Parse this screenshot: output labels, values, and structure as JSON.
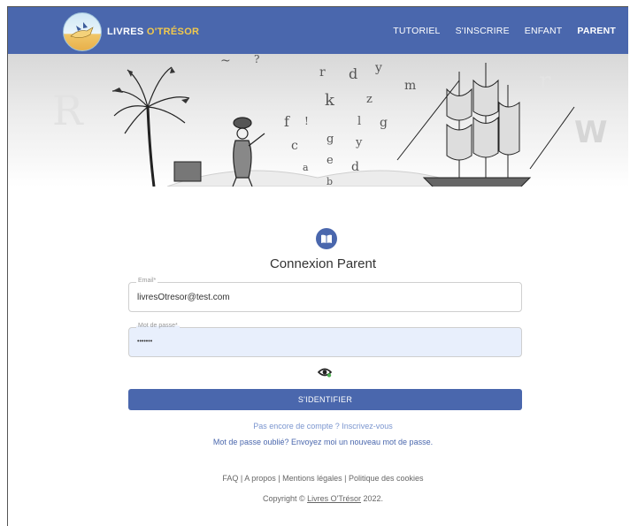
{
  "brand": {
    "part1": "LIVRES ",
    "part2": "O'TRÉSOR"
  },
  "nav": {
    "items": [
      {
        "label": "TUTORIEL"
      },
      {
        "label": "S'INSCRIRE"
      },
      {
        "label": "ENFANT"
      },
      {
        "label": "PARENT"
      }
    ]
  },
  "hero": {
    "letters": [
      "~",
      "?",
      "d",
      "r",
      "y",
      "k",
      "g",
      "m",
      "f",
      "!",
      "l",
      "z",
      "c",
      "g",
      "y",
      "a",
      "e",
      "d",
      "b",
      "R",
      "W",
      "r"
    ]
  },
  "login": {
    "title": "Connexion Parent",
    "email_label": "Email*",
    "email_value": "livresOtresor@test.com",
    "password_label": "Mot de passe*",
    "password_value": "•••••••",
    "submit_label": "S'IDENTIFIER",
    "signup_link": "Pas encore de compte ? Inscrivez-vous",
    "forgot_link": "Mot de passe oublié? Envoyez moi un nouveau mot de passe."
  },
  "footer": {
    "links": "FAQ | A propos | Mentions légales | Politique des cookies",
    "copyright_prefix": "Copyright © ",
    "copyright_brand": "Livres O'Trésor",
    "copyright_suffix": " 2022."
  },
  "colors": {
    "primary": "#4a67ad",
    "accent": "#f2c94c",
    "link_light": "#7a95cf"
  }
}
